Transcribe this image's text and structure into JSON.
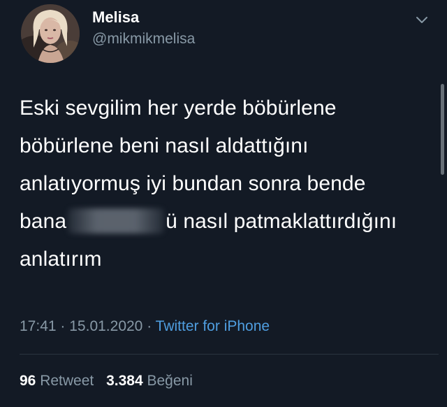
{
  "tweet": {
    "author": {
      "name": "Melisa",
      "handle": "@mikmikmelisa"
    },
    "text_lines": [
      "Eski sevgilim her yerde böbürlene",
      "böbürlene beni nasıl aldattığını",
      "anlatıyormuş iyi bundan sonra bende",
      "bana",
      "ü nasıl patmaklattırdığını",
      "anlatırım"
    ],
    "time": "17:41",
    "date": "15.01.2020",
    "separator": "·",
    "source": "Twitter for iPhone",
    "retweets": {
      "count": "96",
      "label": "Retweet"
    },
    "likes": {
      "count": "3.384",
      "label": "Beğeni"
    }
  },
  "icons": {
    "menu": "chevron-down-icon",
    "avatar": "avatar"
  },
  "colors": {
    "background": "#131a25",
    "text": "#ffffff",
    "secondary": "#8899a6",
    "link": "#4f9ee0",
    "divider": "#2a3440"
  }
}
